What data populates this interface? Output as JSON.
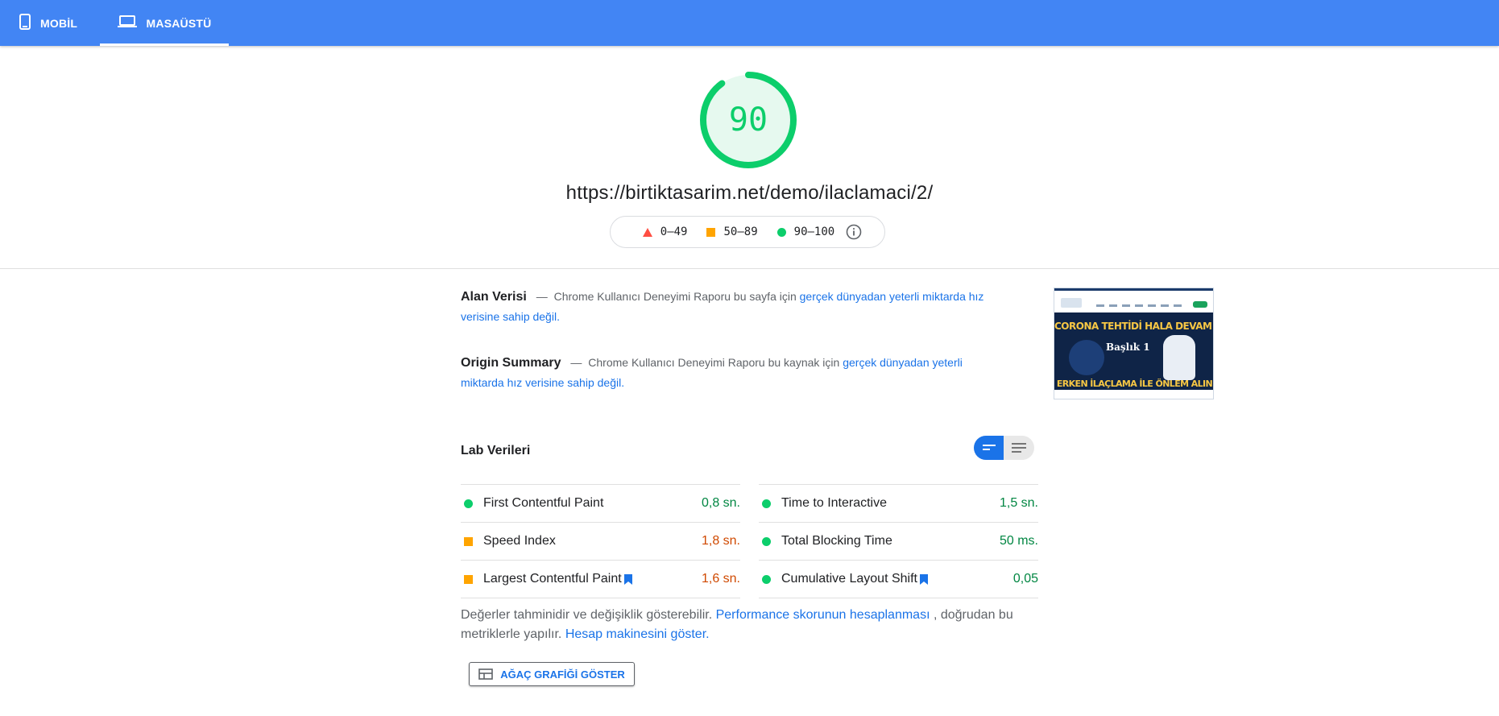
{
  "tabs": {
    "mobile_label": "MOBİL",
    "desktop_label": "MASAÜSTÜ"
  },
  "score": {
    "value": "90",
    "fraction": 0.9,
    "color": "#0cce6b"
  },
  "url": "https://birtiktasarim.net/demo/ilaclamaci/2/",
  "legend": {
    "fail": "0–49",
    "average": "50–89",
    "pass": "90–100"
  },
  "field_data": {
    "title": "Alan Verisi",
    "dash": "—",
    "text": "Chrome Kullanıcı Deneyimi Raporu bu sayfa için",
    "link": "gerçek dünyadan yeterli miktarda hız verisine sahip değil."
  },
  "origin_summary": {
    "title": "Origin Summary",
    "dash": "—",
    "text": "Chrome Kullanıcı Deneyimi Raporu bu kaynak için",
    "link": "gerçek dünyadan yeterli miktarda hız verisine sahip değil."
  },
  "thumbnail": {
    "headline": "CORONA TEHTİDİ HALA DEVAM ETMEKTE",
    "subtitle": "Başlık 1",
    "footer_headline": "ERKEN İLAÇLAMA İLE ÖNLEM ALIN"
  },
  "lab": {
    "title": "Lab Verileri",
    "left": [
      {
        "name": "First Contentful Paint",
        "value": "0,8 sn.",
        "status": "pass"
      },
      {
        "name": "Speed Index",
        "value": "1,8 sn.",
        "status": "average"
      },
      {
        "name": "Largest Contentful Paint",
        "value": "1,6 sn.",
        "status": "average"
      }
    ],
    "right": [
      {
        "name": "Time to Interactive",
        "value": "1,5 sn.",
        "status": "pass"
      },
      {
        "name": "Total Blocking Time",
        "value": "50 ms.",
        "status": "pass"
      },
      {
        "name": "Cumulative Layout Shift",
        "value": "0,05",
        "status": "pass"
      }
    ]
  },
  "note": {
    "text1": "Değerler tahminidir ve değişiklik gösterebilir.",
    "link1": "Performance skorunun hesaplanması",
    "text2": ", doğrudan bu metriklerle yapılır.",
    "link2": "Hesap makinesini göster."
  },
  "treemap_button": "AĞAÇ GRAFİĞİ GÖSTER",
  "colors": {
    "topbar": "#4285f4",
    "pass": "#0cce6b",
    "average": "#ffa400",
    "fail": "#ff4e42",
    "link": "#1a73e8"
  }
}
